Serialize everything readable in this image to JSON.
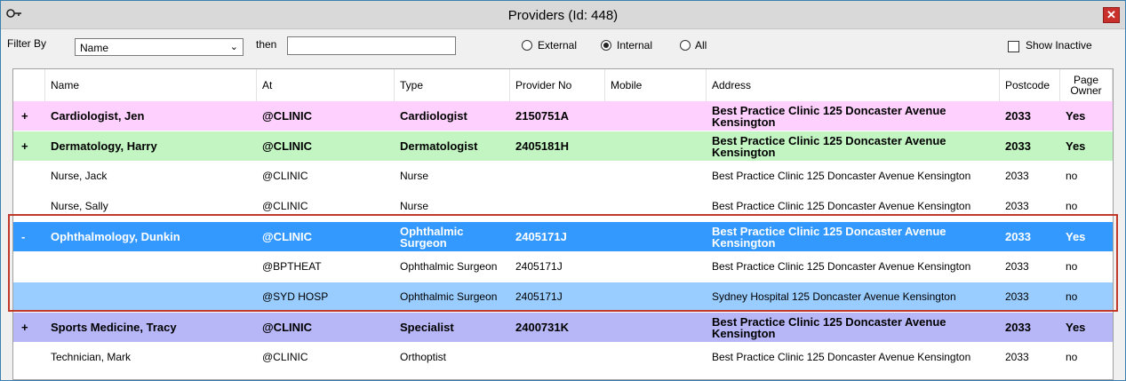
{
  "window": {
    "title": "Providers (Id: 448)",
    "close_label": "✕"
  },
  "filter": {
    "filter_by_label": "Filter By",
    "filter_by_value": "Name",
    "then_label": "then",
    "then_value": "",
    "radio_external": "External",
    "radio_internal": "Internal",
    "radio_all": "All",
    "radio_selected": "Internal",
    "show_inactive_label": "Show Inactive"
  },
  "table": {
    "columns": {
      "name": "Name",
      "at": "At",
      "type": "Type",
      "provider_no": "Provider No",
      "mobile": "Mobile",
      "address": "Address",
      "postcode": "Postcode",
      "page_owner_1": "Page",
      "page_owner_2": "Owner"
    },
    "rows": [
      {
        "expander": "+",
        "name": "Cardiologist, Jen",
        "at": "@CLINIC",
        "type": "Cardiologist",
        "provider_no": "2150751A",
        "mobile": "",
        "address": "Best Practice Clinic 125 Doncaster Avenue Kensington",
        "postcode": "2033",
        "page_owner": "Yes",
        "bg": "#fdd0fd",
        "fg": "#000000",
        "bold": true
      },
      {
        "expander": "+",
        "name": "Dermatology, Harry",
        "at": "@CLINIC",
        "type": "Dermatologist",
        "provider_no": "2405181H",
        "mobile": "",
        "address": "Best Practice Clinic 125 Doncaster Avenue Kensington",
        "postcode": "2033",
        "page_owner": "Yes",
        "bg": "#c2f5c2",
        "fg": "#000000",
        "bold": true
      },
      {
        "expander": "",
        "name": "Nurse, Jack",
        "at": "@CLINIC",
        "type": "Nurse",
        "provider_no": "",
        "mobile": "",
        "address": "Best Practice Clinic 125 Doncaster Avenue Kensington",
        "postcode": "2033",
        "page_owner": "no",
        "bg": "#ffffff",
        "fg": "#000000",
        "bold": false
      },
      {
        "expander": "",
        "name": "Nurse, Sally",
        "at": "@CLINIC",
        "type": "Nurse",
        "provider_no": "",
        "mobile": "",
        "address": "Best Practice Clinic 125 Doncaster Avenue Kensington",
        "postcode": "2033",
        "page_owner": "no",
        "bg": "#ffffff",
        "fg": "#000000",
        "bold": false
      },
      {
        "expander": "-",
        "name": "Ophthalmology, Dunkin",
        "at": "@CLINIC",
        "type": "Ophthalmic Surgeon",
        "provider_no": "2405171J",
        "mobile": "",
        "address": "Best Practice Clinic 125 Doncaster Avenue Kensington",
        "postcode": "2033",
        "page_owner": "Yes",
        "bg": "#3399ff",
        "fg": "#ffffff",
        "bold": true
      },
      {
        "expander": "",
        "name": "",
        "at": "@BPTHEAT",
        "type": "Ophthalmic Surgeon",
        "provider_no": "2405171J",
        "mobile": "",
        "address": "Best Practice Clinic 125 Doncaster Avenue Kensington",
        "postcode": "2033",
        "page_owner": "no",
        "bg": "#ffffff",
        "fg": "#000000",
        "bold": false
      },
      {
        "expander": "",
        "name": "",
        "at": "@SYD HOSP",
        "type": "Ophthalmic Surgeon",
        "provider_no": "2405171J",
        "mobile": "",
        "address": "Sydney Hospital 125 Doncaster Avenue Kensington",
        "postcode": "2033",
        "page_owner": "no",
        "bg": "#99ccff",
        "fg": "#000000",
        "bold": false
      },
      {
        "expander": "+",
        "name": "Sports Medicine, Tracy",
        "at": "@CLINIC",
        "type": "Specialist",
        "provider_no": "2400731K",
        "mobile": "",
        "address": "Best Practice Clinic 125 Doncaster Avenue Kensington",
        "postcode": "2033",
        "page_owner": "Yes",
        "bg": "#b7b7f7",
        "fg": "#000000",
        "bold": true
      },
      {
        "expander": "",
        "name": "Technician, Mark",
        "at": "@CLINIC",
        "type": "Orthoptist",
        "provider_no": "",
        "mobile": "",
        "address": "Best Practice Clinic 125 Doncaster Avenue Kensington",
        "postcode": "2033",
        "page_owner": "no",
        "bg": "#ffffff",
        "fg": "#000000",
        "bold": false
      }
    ]
  },
  "icons": {
    "window": "key-icon",
    "close": "close-icon",
    "dropdown": "chevron-down-icon"
  },
  "colors": {
    "selection_outline": "#c0392b",
    "selected_row": "#3399ff",
    "sub_row_selected": "#99ccff"
  }
}
